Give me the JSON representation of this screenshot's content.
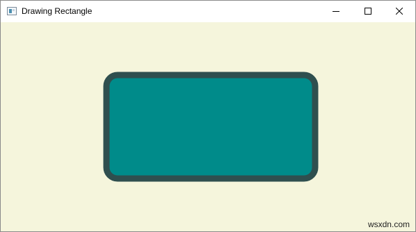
{
  "window": {
    "title": "Drawing Rectangle",
    "icon": "java-app-icon",
    "controls": {
      "minimize_icon": "minimize-icon",
      "maximize_icon": "maximize-icon",
      "close_icon": "close-icon"
    }
  },
  "scene": {
    "background_color": "#f5f5dc",
    "rectangle": {
      "fill_color": "#008b8a",
      "stroke_color": "#2f4f4f"
    }
  },
  "watermark": "wsxdn.com"
}
